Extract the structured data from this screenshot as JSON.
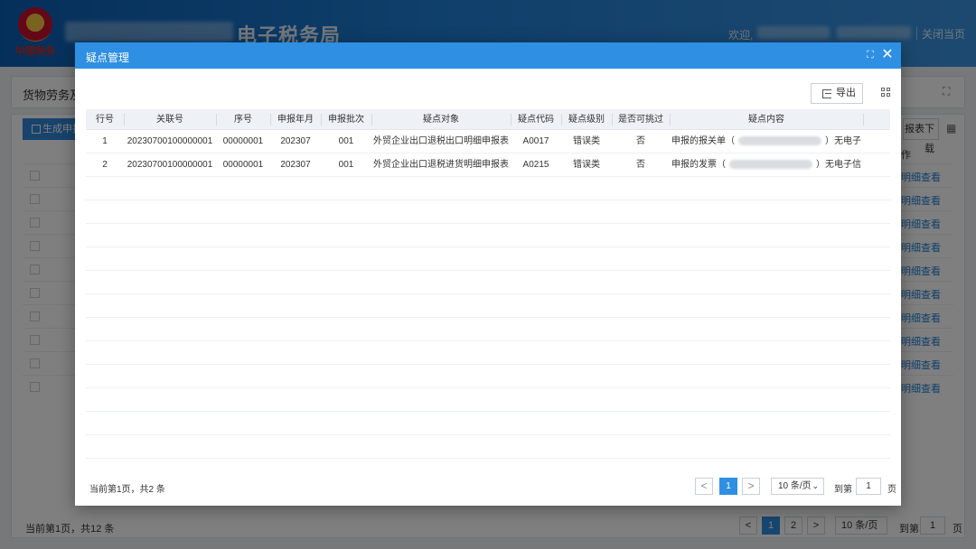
{
  "header": {
    "logo_text": "中国税务",
    "title": "电子税务局",
    "welcome": "欢迎,",
    "close_page": "关闭当页"
  },
  "background": {
    "panel_title": "货物劳务及",
    "generate_button": "生成申报",
    "download_tab": "报表下载",
    "action_column": "作",
    "row_link": "明细查看",
    "row_count": 10,
    "footer": {
      "total": "当前第1页，共12 条",
      "pages": [
        "1",
        "2"
      ],
      "page_size": "10 条/页",
      "goto_prefix": "到第",
      "goto_value": "1",
      "goto_suffix": "页"
    }
  },
  "modal": {
    "title": "疑点管理",
    "export_button": "导出",
    "columns": [
      "行号",
      "关联号",
      "序号",
      "申报年月",
      "申报批次",
      "疑点对象",
      "疑点代码",
      "疑点级别",
      "是否可挑过",
      "疑点内容"
    ],
    "rows": [
      {
        "index": "1",
        "ref_no": "20230700100000001",
        "seq": "00000001",
        "period": "202307",
        "batch": "001",
        "object": "外贸企业出口退税出口明细申报表",
        "code": "A0017",
        "level": "错误类",
        "skippable": "否",
        "content_prefix": "申报的报关单（",
        "content_suffix": "）无电子信..."
      },
      {
        "index": "2",
        "ref_no": "20230700100000001",
        "seq": "00000001",
        "period": "202307",
        "batch": "001",
        "object": "外贸企业出口退税进货明细申报表",
        "code": "A0215",
        "level": "错误类",
        "skippable": "否",
        "content_prefix": "申报的发票（",
        "content_suffix": "）无电子信息，应..."
      }
    ],
    "footer": {
      "total": "当前第1页，共2 条",
      "prev": "<",
      "current_page": "1",
      "next": ">",
      "page_size": "10 条/页",
      "goto_prefix": "到第",
      "goto_value": "1",
      "goto_suffix": "页"
    }
  },
  "colors": {
    "header_blue": "#1f7fd6",
    "modal_head": "#2e8fe3",
    "link": "#1f7fd6",
    "mask": "rgba(0,0,0,0.5)"
  }
}
